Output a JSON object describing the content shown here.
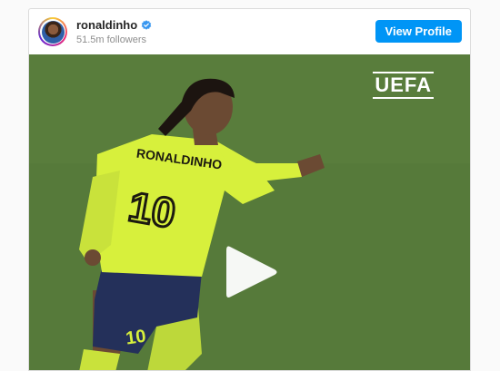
{
  "profile": {
    "username": "ronaldinho",
    "followers": "51.5m followers",
    "verified": true,
    "view_profile_label": "View Profile",
    "button_color": "#0095f6"
  },
  "media": {
    "watermark": "UEFA",
    "jersey_back_text": "RONALDINHO",
    "jersey_number": "10",
    "shorts_number": "10",
    "kit_color": "#d7f03c",
    "shorts_color": "#24305a",
    "pitch_color": "#567a3a",
    "play_icon": "play-icon"
  }
}
